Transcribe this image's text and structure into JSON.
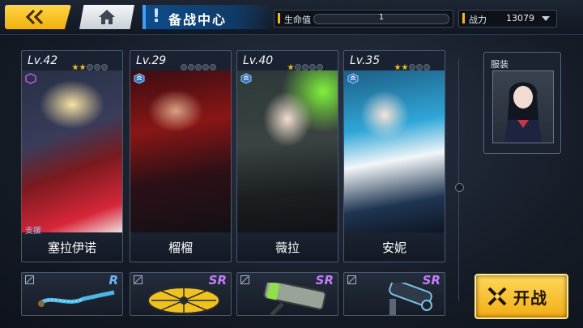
{
  "topbar": {
    "title": "备战中心",
    "title_mark": "!",
    "hp_label": "生命值",
    "hp_value": "1",
    "power_label": "战力",
    "power_value": "13079"
  },
  "heroes": [
    {
      "level": "Lv.42",
      "stars": 2,
      "name": "塞拉伊诺",
      "tag": "支援",
      "energy": 4
    },
    {
      "level": "Lv.29",
      "stars": 0,
      "name": "榴榴",
      "tag": "",
      "energy": 3
    },
    {
      "level": "Lv.40",
      "stars": 1,
      "name": "薇拉",
      "tag": "",
      "energy": 4
    },
    {
      "level": "Lv.35",
      "stars": 2,
      "name": "安妮",
      "tag": "",
      "energy": 2
    }
  ],
  "weapons": [
    {
      "rarity": "R",
      "color": "#6fb4ff",
      "icon": "chain-sword-icon"
    },
    {
      "rarity": "SR",
      "color": "#c77bff",
      "icon": "umbrella-icon"
    },
    {
      "rarity": "SR",
      "color": "#c77bff",
      "icon": "death-hammer-icon"
    },
    {
      "rarity": "SR",
      "color": "#c77bff",
      "icon": "cannon-icon"
    }
  ],
  "side": {
    "costume_label": "服装",
    "start_label": "开战"
  },
  "colors": {
    "accent": "#f2b820",
    "title_bg": "#0d4c8a",
    "support_text": "#7ed0ff"
  }
}
